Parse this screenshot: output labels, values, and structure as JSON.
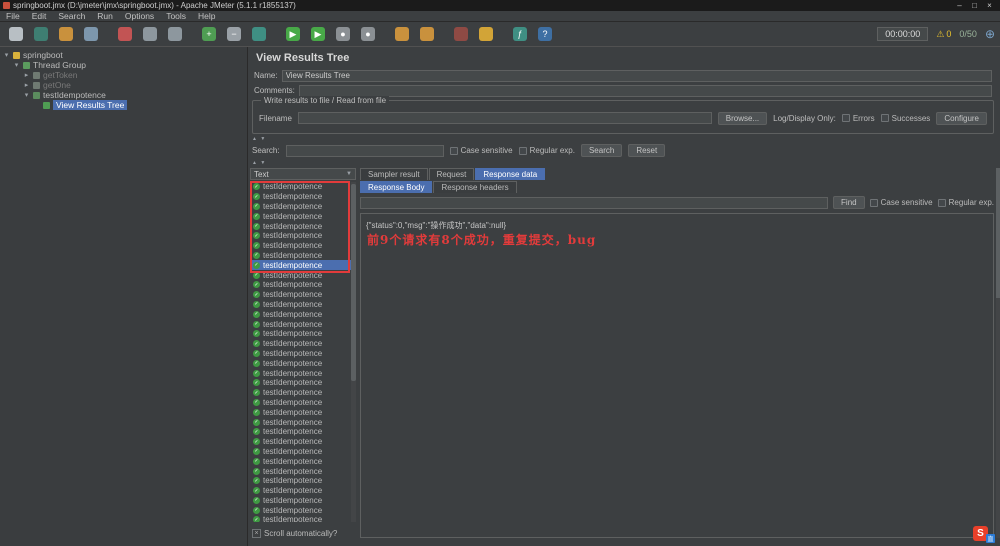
{
  "window": {
    "title": "springboot.jmx (D:\\jmeter\\jmx\\springboot.jmx) - Apache JMeter (5.1.1 r1855137)",
    "minimize_glyph": "–",
    "maximize_glyph": "□",
    "close_glyph": "×"
  },
  "menu": {
    "items": [
      "File",
      "Edit",
      "Search",
      "Run",
      "Options",
      "Tools",
      "Help"
    ]
  },
  "toolbar": {
    "icons": [
      {
        "name": "new-file-icon",
        "glyph": "",
        "color": "#b8bfc4"
      },
      {
        "name": "templates-icon",
        "glyph": "",
        "color": "#3e7e72"
      },
      {
        "name": "open-file-icon",
        "glyph": "",
        "color": "#c9913d"
      },
      {
        "name": "save-icon",
        "glyph": "",
        "color": "#7d97ad"
      },
      {
        "name": "cut-icon",
        "glyph": "",
        "color": "#c25454",
        "gap": true
      },
      {
        "name": "copy-icon",
        "glyph": "",
        "color": "#8d979e"
      },
      {
        "name": "paste-icon",
        "glyph": "",
        "color": "#8d979e"
      },
      {
        "name": "expand-all-icon",
        "glyph": "+",
        "color": "#4f9d53",
        "gap": true
      },
      {
        "name": "collapse-all-icon",
        "glyph": "−",
        "color": "#9aa1a7"
      },
      {
        "name": "toggle-icon",
        "glyph": "",
        "color": "#3f8f83"
      },
      {
        "name": "start-icon",
        "glyph": "▶",
        "color": "#48a948",
        "gap": true
      },
      {
        "name": "start-no-pauses-icon",
        "glyph": "▶",
        "color": "#48a948"
      },
      {
        "name": "stop-icon",
        "glyph": "●",
        "color": "#8b9094"
      },
      {
        "name": "shutdown-icon",
        "glyph": "●",
        "color": "#8b9094"
      },
      {
        "name": "clear-icon",
        "glyph": "",
        "color": "#c9913d",
        "gap": true
      },
      {
        "name": "clear-all-icon",
        "glyph": "",
        "color": "#c9913d"
      },
      {
        "name": "search-icon",
        "glyph": "",
        "color": "#8f4a44",
        "gap": true
      },
      {
        "name": "search-reset-icon",
        "glyph": "",
        "color": "#d2a437"
      },
      {
        "name": "function-helper-icon",
        "glyph": "ƒ",
        "color": "#3f8f83",
        "gap": true
      },
      {
        "name": "help-icon",
        "glyph": "?",
        "color": "#3e6fa3"
      }
    ],
    "timer": "00:00:00",
    "warning_glyph": "⚠",
    "warning_count": "0",
    "thread_count": "0/50",
    "remote_glyph": "⊕"
  },
  "tree": {
    "items": [
      {
        "label": "springboot",
        "indent": 3,
        "arrow": "▾",
        "icon_color": "#d8b13c",
        "state": "normal"
      },
      {
        "label": "Thread Group",
        "indent": 13,
        "arrow": "▾",
        "icon_color": "#5b9c5e",
        "state": "normal"
      },
      {
        "label": "getToken",
        "indent": 23,
        "arrow": "▸",
        "icon_color": "#6f7a72",
        "state": "disabled"
      },
      {
        "label": "getOne",
        "indent": 23,
        "arrow": "▸",
        "icon_color": "#6f7a72",
        "state": "disabled"
      },
      {
        "label": "testIdempotence",
        "indent": 23,
        "arrow": "▾",
        "icon_color": "#5b8c5e",
        "state": "normal"
      },
      {
        "label": "View Results Tree",
        "indent": 33,
        "arrow": "",
        "icon_color": "#4f9d53",
        "state": "selected"
      }
    ]
  },
  "panel": {
    "title": "View Results Tree",
    "name_label": "Name:",
    "name_value": "View Results Tree",
    "comments_label": "Comments:",
    "comments_value": "",
    "file_group": {
      "title": "Write results to file / Read from file",
      "filename_label": "Filename",
      "filename_value": "",
      "browse_label": "Browse...",
      "log_display_label": "Log/Display Only:",
      "errors_label": "Errors",
      "successes_label": "Successes",
      "configure_label": "Configure"
    },
    "search": {
      "label": "Search:",
      "value": "",
      "case_label": "Case sensitive",
      "regex_label": "Regular exp.",
      "search_button": "Search",
      "reset_button": "Reset"
    }
  },
  "results": {
    "filter_value": "Text",
    "filter_arrow": "▼",
    "count": 35,
    "row_label": "testIdempotence",
    "row_glyph": "✓",
    "selected_index": 8,
    "scroll_label": "Scroll automatically?",
    "scroll_glyph": "×"
  },
  "tabs": {
    "items": [
      "Sampler result",
      "Request",
      "Response data"
    ],
    "active": "Response data",
    "subitems": [
      "Response Body",
      "Response headers"
    ],
    "active_sub": "Response Body",
    "find_value": "",
    "find_button": "Find",
    "case_label": "Case sensitive",
    "regex_label": "Regular exp.",
    "response_body": "{\"status\":0,\"msg\":\"操作成功\",\"data\":null}"
  },
  "annotation": {
    "text": "前9个请求有8个成功，重复提交，bug",
    "color": "#e23b3b",
    "box_rows": 9
  },
  "splitter": {
    "up": "▲",
    "down": "▼"
  },
  "watermark": {
    "text": "S",
    "text2": "直"
  }
}
